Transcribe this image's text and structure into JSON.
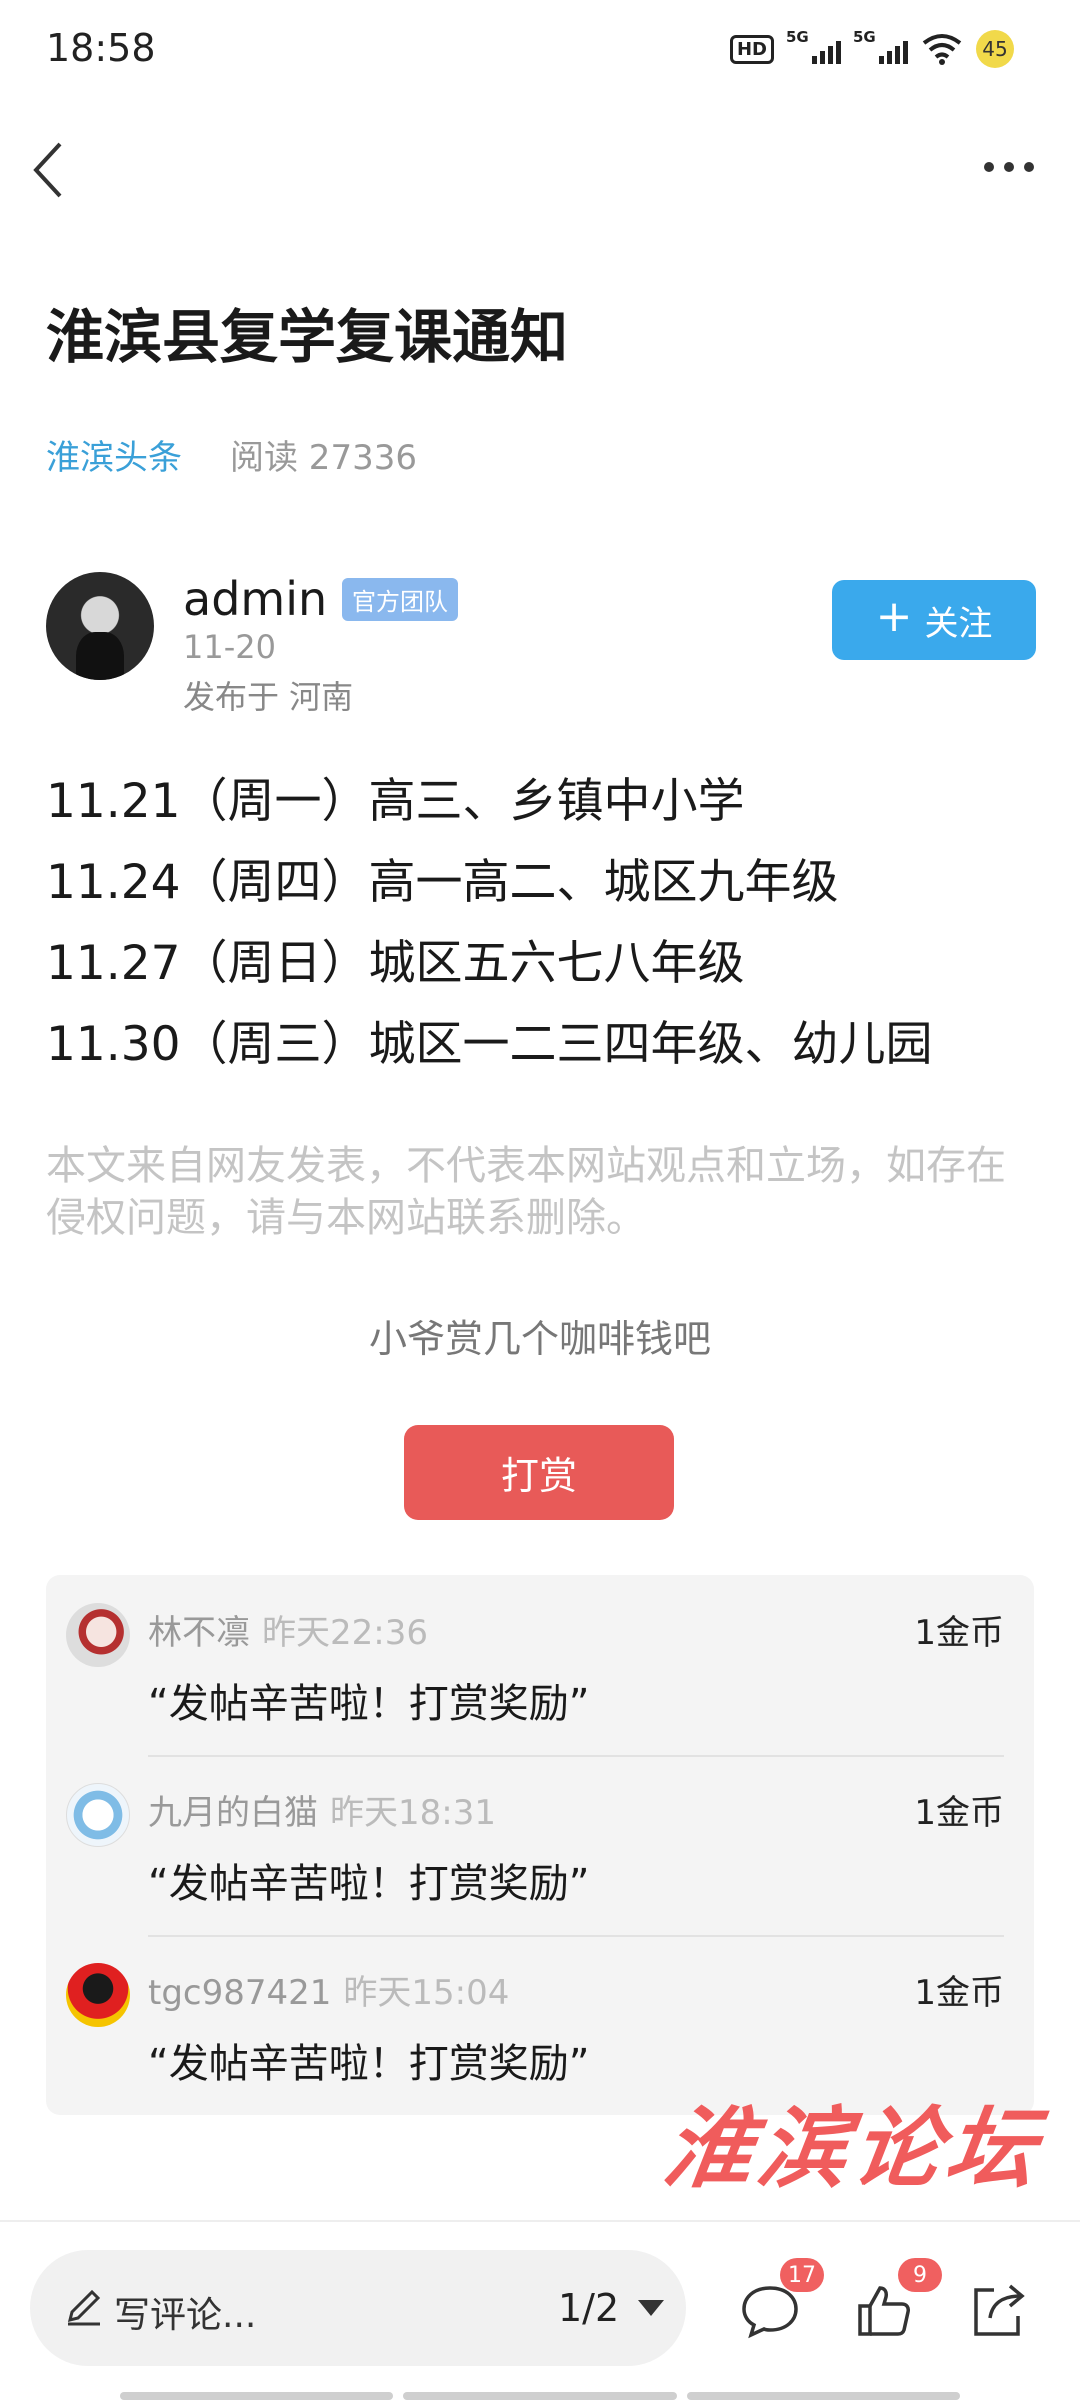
{
  "status_bar": {
    "time": "18:58",
    "hd_label": "HD",
    "network_1": "5G",
    "network_2": "5G",
    "battery": "45"
  },
  "article": {
    "title": "淮滨县复学复课通知",
    "source": "淮滨头条",
    "read_count": "阅读 27336"
  },
  "author": {
    "name": "admin",
    "badge": "官方团队",
    "date": "11-20",
    "location": "发布于 河南",
    "follow_label": "关注"
  },
  "content_lines": [
    "11.21（周一）高三、乡镇中小学",
    "11.24（周四）高一高二、城区九年级",
    "11.27（周日）城区五六七八年级",
    "11.30（周三）城区一二三四年级、幼儿园"
  ],
  "disclaimer": "本文来自网友发表，不代表本网站观点和立场，如存在侵权问题，请与本网站联系删除。",
  "reward": {
    "prompt": "小爷赏几个咖啡钱吧",
    "button_label": "打赏",
    "items": [
      {
        "name": "林不凛",
        "time": "昨天22:36",
        "amount": "1金币",
        "message": "“发帖辛苦啦！打赏奖励”"
      },
      {
        "name": "九月的白猫",
        "time": "昨天18:31",
        "amount": "1金币",
        "message": "“发帖辛苦啦！打赏奖励”"
      },
      {
        "name": "tgc987421",
        "time": "昨天15:04",
        "amount": "1金币",
        "message": "“发帖辛苦啦！打赏奖励”"
      }
    ]
  },
  "watermark": "淮滨论坛",
  "bottom_bar": {
    "comment_placeholder": "写评论...",
    "page_indicator": "1/2",
    "comment_count": "17",
    "like_count": "9"
  },
  "colors": {
    "accent_blue": "#3aa9ec",
    "source_blue": "#3aa0d8",
    "reward_red": "#e85a58",
    "badge_red": "#f06060"
  }
}
